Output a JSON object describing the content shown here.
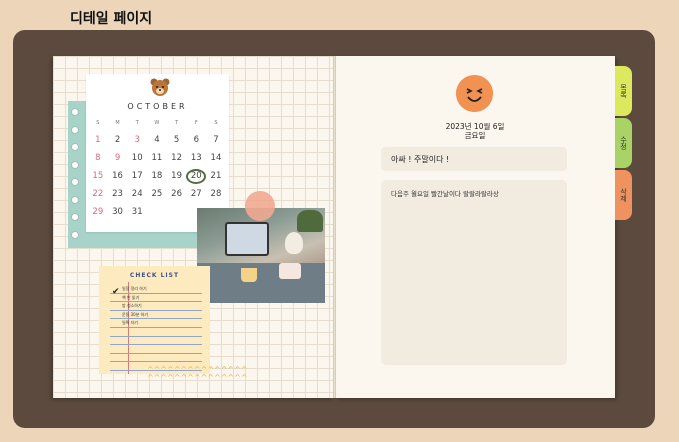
{
  "page": {
    "title": "디테일 페이지"
  },
  "calendar": {
    "month": "OCTOBER",
    "day_headers": [
      "S",
      "M",
      "T",
      "W",
      "T",
      "F",
      "S"
    ],
    "days": [
      {
        "n": "1",
        "c": "sun"
      },
      {
        "n": "2",
        "c": ""
      },
      {
        "n": "3",
        "c": "hol"
      },
      {
        "n": "4",
        "c": ""
      },
      {
        "n": "5",
        "c": ""
      },
      {
        "n": "6",
        "c": ""
      },
      {
        "n": "7",
        "c": ""
      },
      {
        "n": "8",
        "c": "sun"
      },
      {
        "n": "9",
        "c": "hol"
      },
      {
        "n": "10",
        "c": ""
      },
      {
        "n": "11",
        "c": ""
      },
      {
        "n": "12",
        "c": ""
      },
      {
        "n": "13",
        "c": ""
      },
      {
        "n": "14",
        "c": ""
      },
      {
        "n": "15",
        "c": "sun"
      },
      {
        "n": "16",
        "c": ""
      },
      {
        "n": "17",
        "c": ""
      },
      {
        "n": "18",
        "c": ""
      },
      {
        "n": "19",
        "c": ""
      },
      {
        "n": "20",
        "c": "today"
      },
      {
        "n": "21",
        "c": ""
      },
      {
        "n": "22",
        "c": "sun"
      },
      {
        "n": "23",
        "c": ""
      },
      {
        "n": "24",
        "c": ""
      },
      {
        "n": "25",
        "c": ""
      },
      {
        "n": "26",
        "c": ""
      },
      {
        "n": "27",
        "c": ""
      },
      {
        "n": "28",
        "c": ""
      },
      {
        "n": "29",
        "c": "sun"
      },
      {
        "n": "30",
        "c": ""
      },
      {
        "n": "31",
        "c": ""
      }
    ]
  },
  "checklist": {
    "title": "CHECK LIST",
    "items": [
      "일정 정리 하기",
      "책 반 읽기",
      "방 청소하기",
      "운동 30분 하기",
      "일찍 자기"
    ]
  },
  "entry": {
    "date": "2023년 10월 6일",
    "weekday": "금요일",
    "title": "아싸 ! 주말이다 !",
    "content": "다음주 월요일 빨간날이다 랄랄라랄라상"
  },
  "tabs": {
    "list": "목록",
    "edit": "수정",
    "delete": "삭제"
  },
  "colors": {
    "background": "#ecd5b8",
    "frame": "#5c4a3e",
    "tab_list": "#dce85e",
    "tab_edit": "#a9d465",
    "tab_delete": "#f0925f",
    "avatar": "#f19152"
  },
  "icons": {
    "avatar": "smiling-face-icon",
    "bear": "bear-icon",
    "check": "checkmark-icon"
  }
}
